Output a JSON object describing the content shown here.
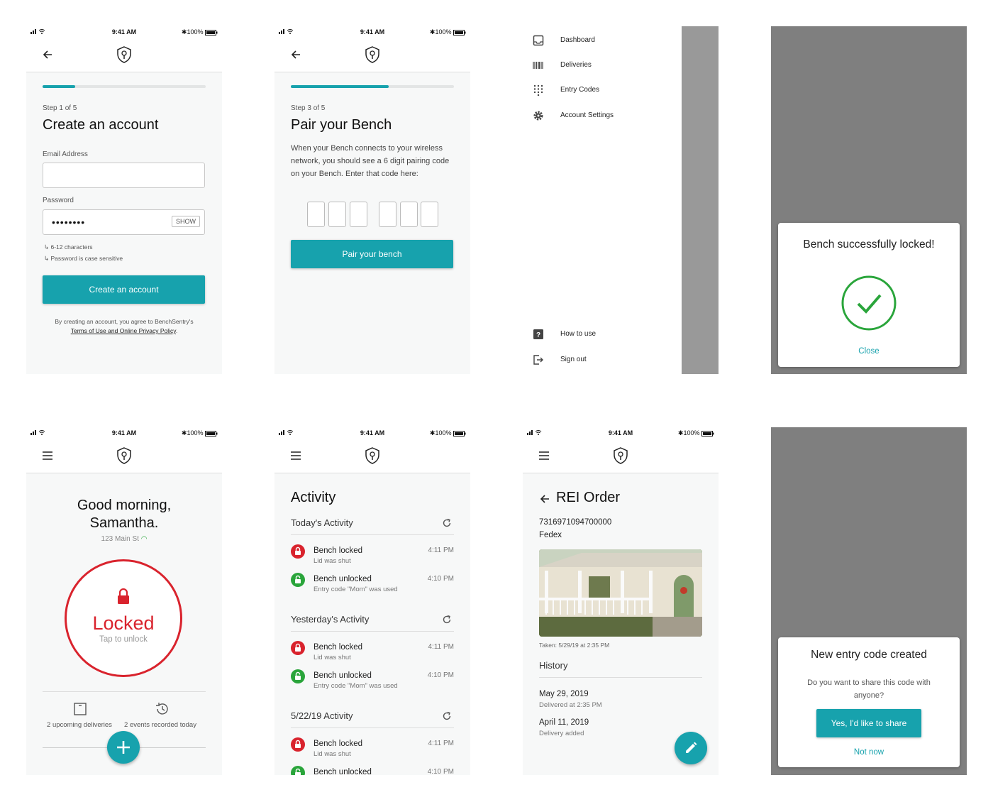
{
  "status": {
    "time": "9:41 AM",
    "battery": "100%"
  },
  "colors": {
    "accent": "#17a2ad",
    "danger": "#d9232d",
    "success": "#2aa53b"
  },
  "create_account": {
    "step": "Step 1 of 5",
    "progress": 0.2,
    "title": "Create an account",
    "email_label": "Email Address",
    "email_value": "",
    "password_label": "Password",
    "password_value": "••••••••",
    "show_label": "SHOW",
    "hints": [
      "6-12 characters",
      "Password is case sensitive"
    ],
    "button": "Create an account",
    "terms_prefix": "By creating an account, you agree to BenchSentry's",
    "terms_link": "Terms of Use and Online Privacy Policy",
    "terms_suffix": "."
  },
  "pair": {
    "step": "Step 3 of 5",
    "progress": 0.6,
    "title": "Pair your Bench",
    "description": "When your Bench connects to your wireless network, you should see a 6 digit pairing code on your Bench. Enter that code here:",
    "button": "Pair your bench"
  },
  "menu": {
    "items": [
      {
        "label": "Dashboard",
        "icon": "inbox-icon"
      },
      {
        "label": "Deliveries",
        "icon": "barcode-icon"
      },
      {
        "label": "Entry Codes",
        "icon": "keypad-icon"
      },
      {
        "label": "Account Settings",
        "icon": "gear-icon"
      }
    ],
    "bottom_items": [
      {
        "label": "How to use",
        "icon": "help-icon"
      },
      {
        "label": "Sign out",
        "icon": "sign-out-icon"
      }
    ]
  },
  "locked_dialog": {
    "title": "Bench successfully locked!",
    "close": "Close"
  },
  "home": {
    "greeting": "Good morning, Samantha.",
    "address": "123 Main St",
    "lock_state": "Locked",
    "lock_hint": "Tap to unlock",
    "stat_deliveries": "2 upcoming deliveries",
    "stat_events": "2 events recorded today"
  },
  "activity": {
    "title": "Activity",
    "sections": [
      {
        "heading": "Today's Activity",
        "items": [
          {
            "title": "Bench locked",
            "subtitle": "Lid was shut",
            "time": "4:11 PM",
            "kind": "locked"
          },
          {
            "title": "Bench unlocked",
            "subtitle": "Entry code \"Mom\" was used",
            "time": "4:10 PM",
            "kind": "unlocked"
          }
        ]
      },
      {
        "heading": "Yesterday's Activity",
        "items": [
          {
            "title": "Bench locked",
            "subtitle": "Lid was shut",
            "time": "4:11 PM",
            "kind": "locked"
          },
          {
            "title": "Bench unlocked",
            "subtitle": "Entry code \"Mom\" was used",
            "time": "4:10 PM",
            "kind": "unlocked"
          }
        ]
      },
      {
        "heading": "5/22/19 Activity",
        "items": [
          {
            "title": "Bench locked",
            "subtitle": "Lid was shut",
            "time": "4:11 PM",
            "kind": "locked"
          },
          {
            "title": "Bench unlocked",
            "subtitle": "",
            "time": "4:10 PM",
            "kind": "unlocked"
          }
        ]
      }
    ]
  },
  "order": {
    "title": "REI Order",
    "tracking": "7316971094700000",
    "carrier": "Fedex",
    "photo_caption": "Taken: 5/29/19 at 2:35 PM",
    "history_heading": "History",
    "history": [
      {
        "date": "May 29, 2019",
        "detail": "Delivered at 2:35 PM"
      },
      {
        "date": "April 11, 2019",
        "detail": "Delivery added"
      }
    ]
  },
  "entry_dialog": {
    "title": "New entry code created",
    "message": "Do you want to share this code with anyone?",
    "primary": "Yes, I'd like to share",
    "secondary": "Not now"
  }
}
